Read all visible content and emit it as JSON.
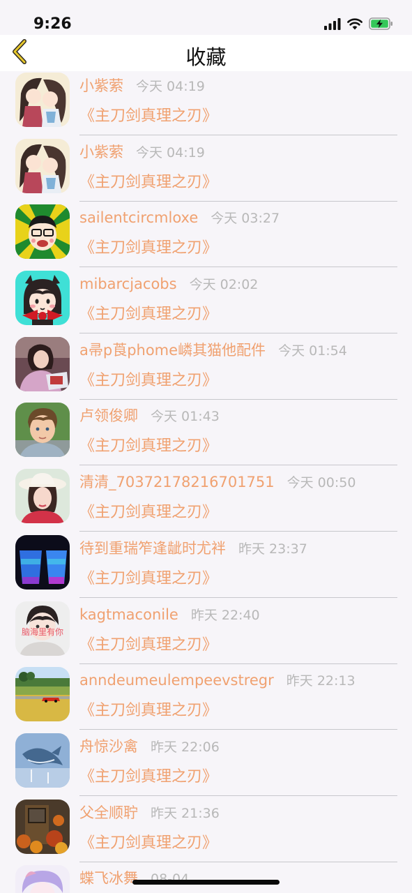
{
  "status_bar": {
    "time": "9:26"
  },
  "nav": {
    "title": "收藏",
    "back_icon": "chevron-left-icon"
  },
  "colors": {
    "accent": "#f0a170",
    "timestamp": "#b8b8b8",
    "background": "#f7f5f9"
  },
  "items": [
    {
      "name": "小紫萦",
      "time": "今天 04:19",
      "title": "《主刀剑真理之刃》",
      "avatar": "anime-couple-avatar"
    },
    {
      "name": "小紫萦",
      "time": "今天 04:19",
      "title": "《主刀剑真理之刃》",
      "avatar": "anime-couple-avatar"
    },
    {
      "name": "sailentcircmloxe",
      "time": "今天 03:27",
      "title": "《主刀剑真理之刃》",
      "avatar": "cartoon-glasses-avatar"
    },
    {
      "name": "mibarcjacobs",
      "time": "今天 02:02",
      "title": "《主刀剑真理之刃》",
      "avatar": "cartoon-girl-bow-avatar"
    },
    {
      "name": "a帚p莨phome嶙其猫他配件",
      "time": "今天 01:54",
      "title": "《主刀剑真理之刃》",
      "avatar": "girl-photo-avatar"
    },
    {
      "name": "卢领俊卿",
      "time": "今天 01:43",
      "title": "《主刀剑真理之刃》",
      "avatar": "boy-photo-avatar"
    },
    {
      "name": "清清_70372178216701751",
      "time": "今天 00:50",
      "title": "《主刀剑真理之刃》",
      "avatar": "woman-hat-avatar"
    },
    {
      "name": "待到重瑞笮逢龇时尤袢",
      "time": "昨天 23:37",
      "title": "《主刀剑真理之刃》",
      "avatar": "neon-cups-avatar"
    },
    {
      "name": "kagtmaconile",
      "time": "昨天 22:40",
      "title": "《主刀剑真理之刃》",
      "avatar": "portrait-text-avatar",
      "avatar_text": "脑海里有你"
    },
    {
      "name": "anndeumeulempeevstregr",
      "time": "昨天 22:13",
      "title": "《主刀剑真理之刃》",
      "avatar": "red-car-field-avatar"
    },
    {
      "name": "舟惊沙禽",
      "time": "昨天 22:06",
      "title": "《主刀剑真理之刃》",
      "avatar": "whale-sky-avatar"
    },
    {
      "name": "父全顺聍",
      "time": "昨天 21:36",
      "title": "《主刀剑真理之刃》",
      "avatar": "autumn-door-avatar"
    },
    {
      "name": "蝶飞冰舞",
      "time": "08-04",
      "title": "",
      "avatar": "anime-purple-hair-avatar"
    }
  ]
}
